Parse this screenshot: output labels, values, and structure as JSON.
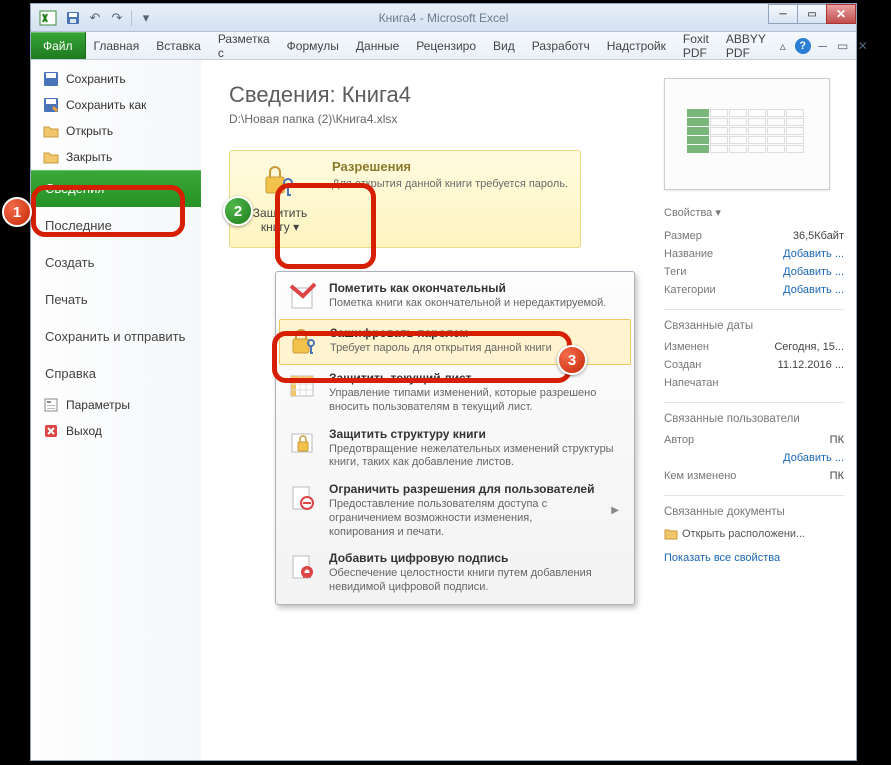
{
  "title": "Книга4 - Microsoft Excel",
  "qat": {
    "save": "save",
    "undo": "undo",
    "redo": "redo"
  },
  "tabs": [
    "Файл",
    "Главная",
    "Вставка",
    "Разметка с",
    "Формулы",
    "Данные",
    "Рецензиро",
    "Вид",
    "Разработч",
    "Надстройк",
    "Foxit PDF",
    "ABBYY PDF"
  ],
  "nav": {
    "save": "Сохранить",
    "save_as": "Сохранить как",
    "open": "Открыть",
    "close": "Закрыть",
    "info": "Сведения",
    "recent": "Последние",
    "new": "Создать",
    "print": "Печать",
    "share": "Сохранить и отправить",
    "help": "Справка",
    "options": "Параметры",
    "exit": "Выход"
  },
  "info": {
    "heading": "Сведения: Книга4",
    "path": "D:\\Новая папка (2)\\Книга4.xlsx"
  },
  "protect": {
    "label": "Защитить книгу",
    "perm_title": "Разрешения",
    "perm_desc": "Для открытия данной книги требуется пароль."
  },
  "menu": [
    {
      "title": "Пометить как окончательный",
      "desc": "Пометка книги как окончательной и нередактируемой."
    },
    {
      "title": "Зашифровать паролем",
      "desc": "Требует пароль для открытия данной книги"
    },
    {
      "title": "Защитить текущий лист",
      "desc": "Управление типами изменений, которые разрешено вносить пользователям в текущий лист."
    },
    {
      "title": "Защитить структуру книги",
      "desc": "Предотвращение нежелательных изменений структуры книги, таких как добавление листов."
    },
    {
      "title": "Ограничить разрешения для пользователей",
      "desc": "Предоставление пользователям доступа с ограничением возможности изменения, копирования и печати."
    },
    {
      "title": "Добавить цифровую подпись",
      "desc": "Обеспечение целостности книги путем добавления невидимой цифровой подписи."
    }
  ],
  "props": {
    "label": "Свойства",
    "size_k": "Размер",
    "size_v": "36,5Кбайт",
    "title_k": "Название",
    "title_v": "Добавить ...",
    "tags_k": "Теги",
    "tags_v": "Добавить ...",
    "cat_k": "Категории",
    "cat_v": "Добавить ...",
    "dates_h": "Связанные даты",
    "mod_k": "Изменен",
    "mod_v": "Сегодня, 15...",
    "created_k": "Создан",
    "created_v": "11.12.2016 ...",
    "printed_k": "Напечатан",
    "users_h": "Связанные пользователи",
    "author_k": "Автор",
    "author_v": "ПК",
    "add_author": "Добавить ...",
    "changed_k": "Кем изменено",
    "changed_v": "ПК",
    "docs_h": "Связанные документы",
    "open_loc": "Открыть расположени...",
    "show_all": "Показать все свойства"
  },
  "callouts": {
    "one": "1",
    "two": "2",
    "three": "3"
  }
}
